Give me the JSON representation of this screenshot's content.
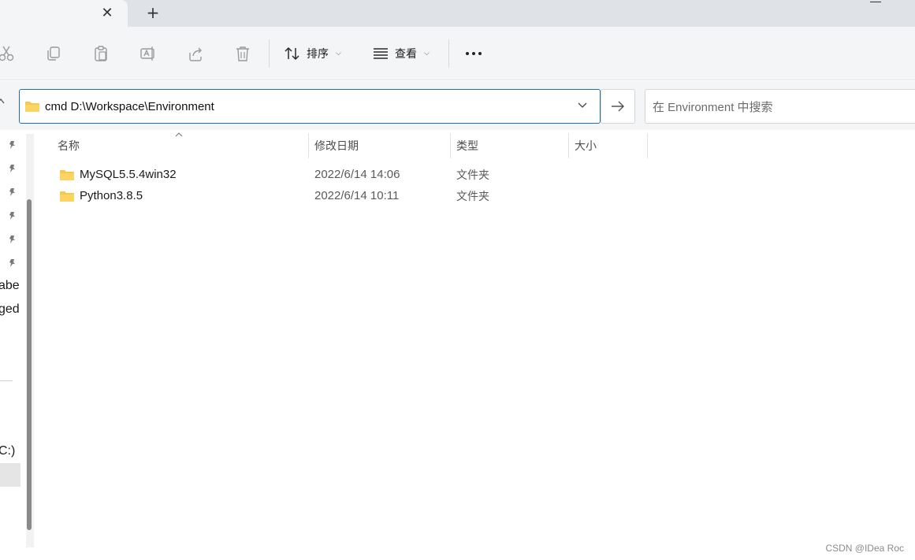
{
  "tabbar": {
    "close_icon": "close-icon",
    "new_tab_icon": "plus-icon",
    "close_glyph": "✕",
    "plus_glyph": "+"
  },
  "toolbar": {
    "icons": [
      "cut-icon",
      "copy-icon",
      "paste-icon",
      "rename-icon",
      "share-icon",
      "delete-icon"
    ],
    "sort_label": "排序",
    "view_label": "查看",
    "more_icon": "more-icon"
  },
  "address": {
    "value": "cmd D:\\Workspace\\Environment",
    "search_placeholder": "在 Environment 中搜索"
  },
  "navpane": {
    "partial_labels": [
      "abe",
      "ged",
      "C:)"
    ]
  },
  "filelist": {
    "columns": [
      "名称",
      "修改日期",
      "类型",
      "大小"
    ],
    "rows": [
      {
        "name": "MySQL5.5.4win32",
        "date": "2022/6/14 14:06",
        "type": "文件夹",
        "size": ""
      },
      {
        "name": "Python3.8.5",
        "date": "2022/6/14 10:11",
        "type": "文件夹",
        "size": ""
      }
    ]
  },
  "watermark": "CSDN @IDea Roc",
  "colors": {
    "accent_border": "#1f6fb3",
    "folder_yellow": "#f7c948",
    "chrome_bg": "#f3f5f7"
  }
}
